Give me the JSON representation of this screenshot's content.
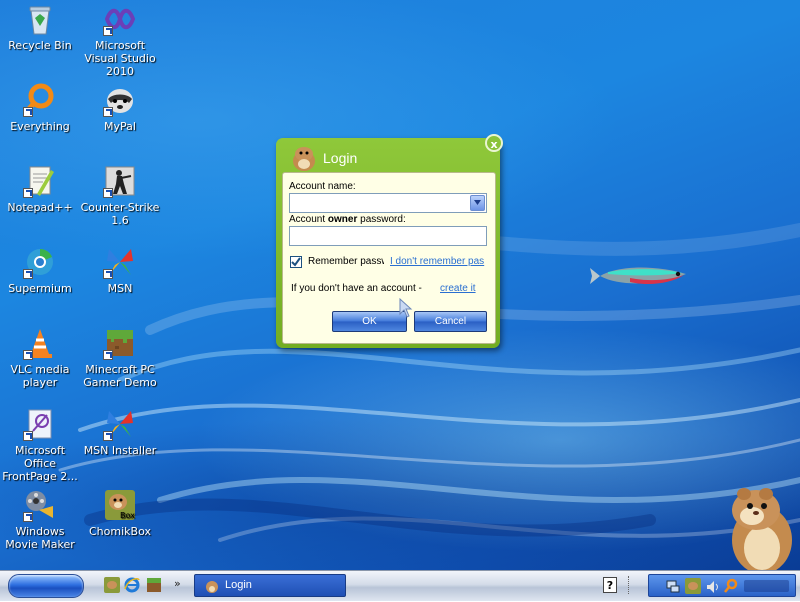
{
  "desktop": {
    "icons": [
      {
        "label": "Recycle Bin",
        "icon": "recycle-bin-icon"
      },
      {
        "label": "Microsoft Visual Studio 2010",
        "icon": "visual-studio-icon"
      },
      {
        "label": "Everything",
        "icon": "everything-search-icon"
      },
      {
        "label": "MyPal",
        "icon": "mypal-browser-icon"
      },
      {
        "label": "Notepad++",
        "icon": "notepad-plus-plus-icon"
      },
      {
        "label": "Counter-Strike 1.6",
        "icon": "counter-strike-icon"
      },
      {
        "label": "Supermium",
        "icon": "supermium-browser-icon"
      },
      {
        "label": "MSN",
        "icon": "msn-butterfly-icon"
      },
      {
        "label": "VLC media player",
        "icon": "vlc-cone-icon"
      },
      {
        "label": "Minecraft PC Gamer Demo",
        "icon": "minecraft-grass-block-icon"
      },
      {
        "label": "Microsoft Office FrontPage 2...",
        "icon": "frontpage-icon"
      },
      {
        "label": "MSN Installer",
        "icon": "msn-butterfly-icon"
      },
      {
        "label": "Windows Movie Maker",
        "icon": "movie-maker-film-icon"
      },
      {
        "label": "ChomikBox",
        "icon": "chomikbox-hamster-icon",
        "badge": "Box"
      }
    ]
  },
  "login": {
    "title": "Login",
    "close_label": "x",
    "account_name_label": "Account name:",
    "account_name_value": "",
    "password_label_prefix": "Account ",
    "password_label_bold": "owner",
    "password_label_suffix": " password:",
    "password_value": "",
    "remember_label": "Remember passw",
    "remember_checked": true,
    "forgot_link": "I don't remember pas",
    "signup_text": "If you don't have an account - ",
    "signup_link": "create it",
    "ok_label": "OK",
    "cancel_label": "Cancel"
  },
  "taskbar": {
    "quick_launch": [
      "chomikbox-icon",
      "internet-explorer-icon",
      "minecraft-icon"
    ],
    "overflow": "»",
    "tasks": [
      {
        "label": "Login",
        "icon": "chomikbox-hamster-icon"
      }
    ],
    "help_icon": "help-icon",
    "tray_icons": [
      "network-icon",
      "chomikbox-icon",
      "volume-icon",
      "search-icon"
    ]
  },
  "colors": {
    "dialog_green": "#7fb82c",
    "dialog_panel": "#ffffe6",
    "link_blue": "#2a6fd1",
    "taskbar_button": "#2a5fc4"
  }
}
